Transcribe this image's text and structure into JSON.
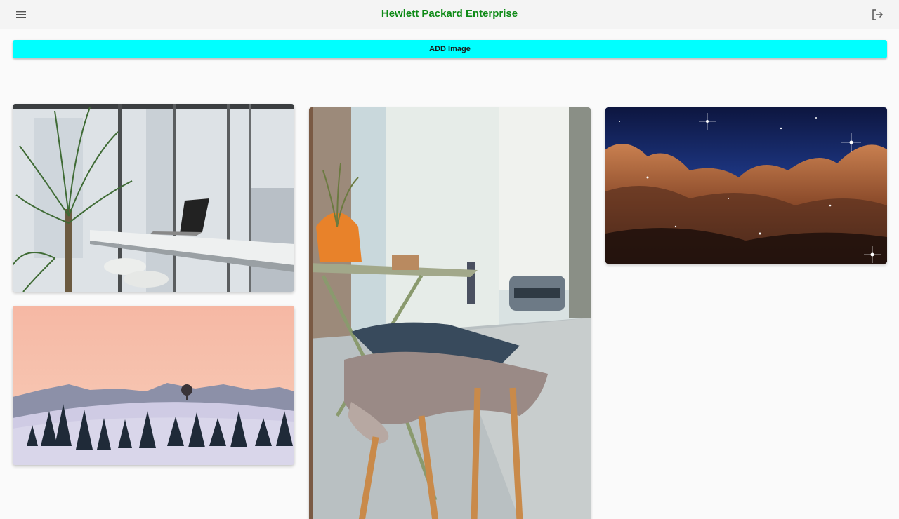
{
  "header": {
    "title": "Hewlett Packard Enterprise",
    "menu_icon": "hamburger-menu-icon",
    "logout_icon": "logout-icon",
    "title_color": "#0e8a16"
  },
  "toolbar": {
    "add_label": "ADD Image",
    "add_color": "#00ffff"
  },
  "gallery": {
    "images": [
      {
        "subject": "office-with-plant-and-laptop"
      },
      {
        "subject": "snowy-mountains-at-dusk"
      },
      {
        "subject": "street-cafe-table-with-fur"
      },
      {
        "subject": "space-nebula"
      }
    ]
  }
}
